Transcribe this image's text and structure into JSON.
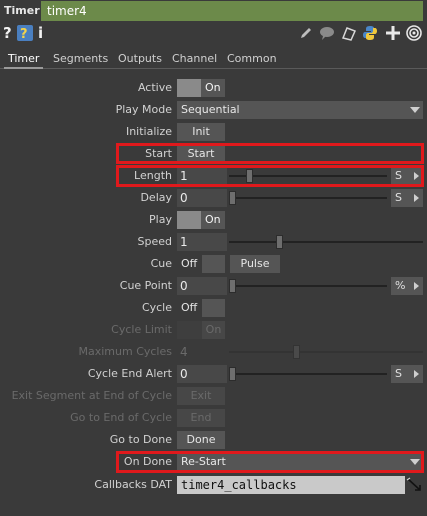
{
  "header": {
    "op_type": "Timer",
    "op_name": "timer4"
  },
  "iconbar": {
    "help": "?",
    "info": "i"
  },
  "tabs": [
    {
      "label": "Timer",
      "active": true
    },
    {
      "label": "Segments"
    },
    {
      "label": "Outputs"
    },
    {
      "label": "Channel"
    },
    {
      "label": "Common"
    }
  ],
  "params": {
    "active": {
      "label": "Active",
      "value": "On"
    },
    "play_mode": {
      "label": "Play Mode",
      "value": "Sequential"
    },
    "initialize": {
      "label": "Initialize",
      "button": "Init"
    },
    "start": {
      "label": "Start",
      "button": "Start"
    },
    "length": {
      "label": "Length",
      "value": "1",
      "unit": "S",
      "slider_fraction": 0.08
    },
    "delay": {
      "label": "Delay",
      "value": "0",
      "unit": "S",
      "slider_fraction": 0.0
    },
    "play": {
      "label": "Play",
      "value": "On"
    },
    "speed": {
      "label": "Speed",
      "value": "1",
      "slider_fraction": 0.5
    },
    "cue": {
      "label": "Cue",
      "value": "Off",
      "button": "Pulse"
    },
    "cue_point": {
      "label": "Cue Point",
      "value": "0",
      "unit": "%",
      "slider_fraction": 0.0
    },
    "cycle": {
      "label": "Cycle",
      "value": "Off"
    },
    "cycle_limit": {
      "label": "Cycle Limit",
      "value": "On"
    },
    "maximum_cycles": {
      "label": "Maximum Cycles",
      "value": "4",
      "slider_fraction": 0.5
    },
    "cycle_end_alert": {
      "label": "Cycle End Alert",
      "value": "0",
      "unit": "S",
      "slider_fraction": 0.0
    },
    "exit_segment": {
      "label": "Exit Segment at End of Cycle",
      "button": "Exit"
    },
    "go_to_end": {
      "label": "Go to End of Cycle",
      "button": "End"
    },
    "go_to_done": {
      "label": "Go to Done",
      "button": "Done"
    },
    "on_done": {
      "label": "On Done",
      "value": "Re-Start"
    },
    "callbacks_dat": {
      "label": "Callbacks DAT",
      "value": "timer4_callbacks"
    }
  },
  "colors": {
    "highlight": "#e0191c",
    "name_bg": "#6c8a4a",
    "panel_bg": "#3a3a3a"
  }
}
